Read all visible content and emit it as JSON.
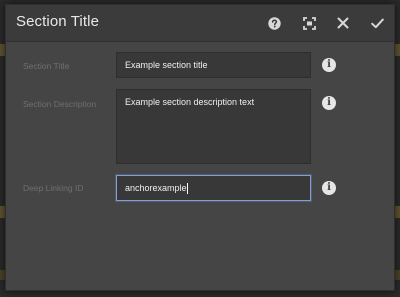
{
  "dialog": {
    "title": "Section Title",
    "header_buttons": [
      {
        "name": "help",
        "icon": "help-icon"
      },
      {
        "name": "fullscreen",
        "icon": "fullscreen-icon"
      },
      {
        "name": "close",
        "icon": "close-icon"
      },
      {
        "name": "done",
        "icon": "checkmark-icon"
      }
    ]
  },
  "form": {
    "section_title": {
      "label": "Section Title",
      "value": "Example section title"
    },
    "section_description": {
      "label": "Section Description",
      "value": "Example section description text"
    },
    "deep_linking_id": {
      "label": "Deep Linking ID",
      "value": "anchorexample"
    },
    "info_glyph": "i"
  },
  "colors": {
    "dialog_bg": "#454545",
    "header_bg": "#3b3b3b",
    "field_bg": "#383838",
    "focus_border": "#7f9fd6",
    "backdrop_accent": "#5e5230"
  }
}
